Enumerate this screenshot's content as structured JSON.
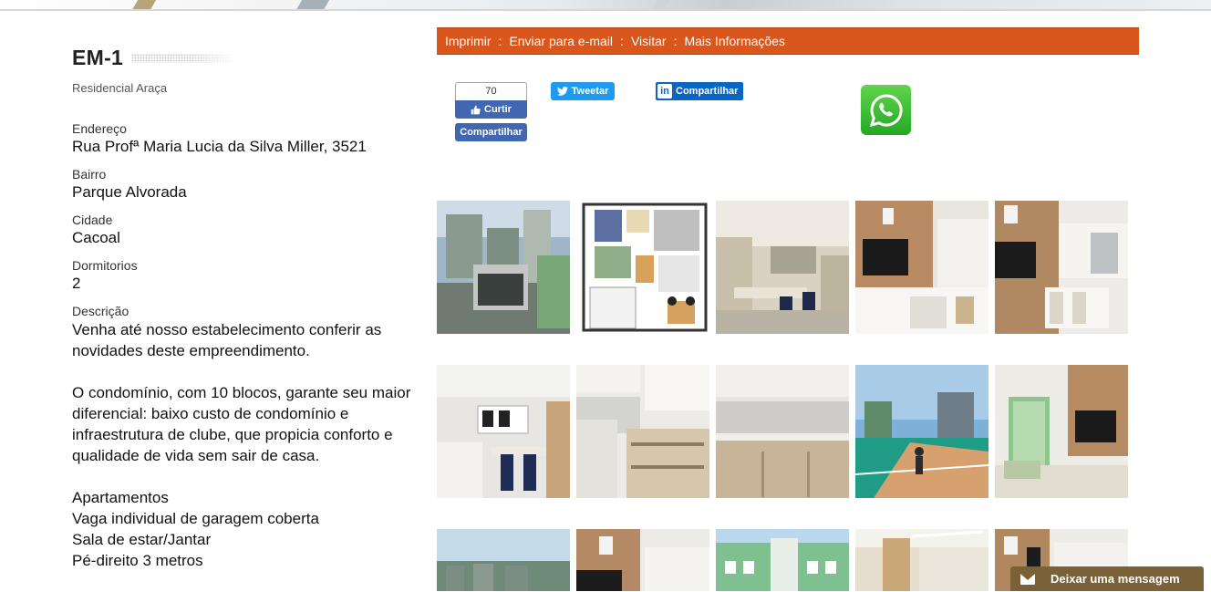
{
  "property": {
    "code": "EM-1",
    "name": "Residencial Araça",
    "fields": [
      {
        "label": "Endereço",
        "value": "Rua Profª Maria Lucia da Silva Miller, 3521"
      },
      {
        "label": "Bairro",
        "value": "Parque Alvorada"
      },
      {
        "label": "Cidade",
        "value": "Cacoal"
      },
      {
        "label": "Dormitorios",
        "value": "2"
      }
    ],
    "description_label": "Descrição",
    "description": [
      "Venha até nosso estabelecimento conferir as novidades deste empreendimento.",
      "O condomínio, com 10 blocos, garante seu maior diferencial: baixo custo de condomínio e infraestrutura de clube, que propicia conforto e qualidade de vida sem sair de casa.",
      "Apartamentos\nVaga individual de garagem coberta\nSala de estar/Jantar\nPé-direito 3 metros"
    ]
  },
  "actions": {
    "print": "Imprimir",
    "email": "Enviar para e-mail",
    "visit": "Visitar",
    "more": "Mais Informações",
    "separator": ":"
  },
  "social": {
    "fb_count": "70",
    "fb_like": "Curtir",
    "fb_share": "Compartilhar",
    "tweet": "Tweetar",
    "linkedin_share": "Compartilhar",
    "whatsapp": "whatsapp-icon"
  },
  "gallery": [
    {
      "kind": "exterior-building"
    },
    {
      "kind": "floor-plan"
    },
    {
      "kind": "dining-room"
    },
    {
      "kind": "living-room-tv"
    },
    {
      "kind": "living-room-shelves"
    },
    {
      "kind": "dining-kitchen"
    },
    {
      "kind": "kitchen-laundry"
    },
    {
      "kind": "kitchen-counter"
    },
    {
      "kind": "sports-court"
    },
    {
      "kind": "living-balcony"
    },
    {
      "kind": "exterior-aerial"
    },
    {
      "kind": "interior-wood"
    },
    {
      "kind": "building-facade"
    },
    {
      "kind": "interior-light"
    },
    {
      "kind": "interior-shelves"
    }
  ],
  "chat": {
    "label": "Deixar uma mensagem"
  },
  "colors": {
    "menu_bar": "#d9561c",
    "facebook": "#4267b2",
    "twitter": "#1d9bf0",
    "linkedin": "#0a66c2",
    "whatsapp": "#25d366",
    "chat": "#7a6137"
  }
}
